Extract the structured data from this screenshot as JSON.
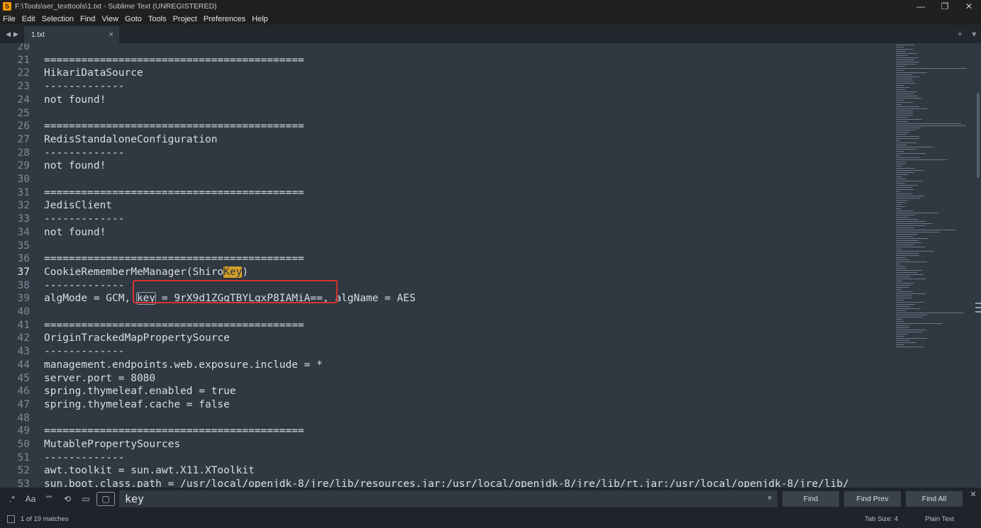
{
  "window": {
    "title": "F:\\Tools\\ser_texttools\\1.txt - Sublime Text (UNREGISTERED)"
  },
  "menu": [
    "File",
    "Edit",
    "Selection",
    "Find",
    "View",
    "Goto",
    "Tools",
    "Project",
    "Preferences",
    "Help"
  ],
  "tab": {
    "label": "1.txt",
    "close": "×"
  },
  "lines": [
    {
      "n": "20",
      "text": ""
    },
    {
      "n": "21",
      "text": "=========================================="
    },
    {
      "n": "22",
      "text": "HikariDataSource"
    },
    {
      "n": "23",
      "text": "-------------"
    },
    {
      "n": "24",
      "text": "not found!"
    },
    {
      "n": "25",
      "text": ""
    },
    {
      "n": "26",
      "text": "=========================================="
    },
    {
      "n": "27",
      "text": "RedisStandaloneConfiguration"
    },
    {
      "n": "28",
      "text": "-------------"
    },
    {
      "n": "29",
      "text": "not found!"
    },
    {
      "n": "30",
      "text": ""
    },
    {
      "n": "31",
      "text": "=========================================="
    },
    {
      "n": "32",
      "text": "JedisClient"
    },
    {
      "n": "33",
      "text": "-------------"
    },
    {
      "n": "34",
      "text": "not found!"
    },
    {
      "n": "35",
      "text": ""
    },
    {
      "n": "36",
      "text": "=========================================="
    },
    {
      "n": "37",
      "text": "",
      "pre": "CookieRememberMeManager(Shiro",
      "mark": "Key",
      "post": ")"
    },
    {
      "n": "38",
      "text": "-------------"
    },
    {
      "n": "39",
      "text": "",
      "pre": "algMode = GCM, ",
      "box": "key",
      "post": " = 9rX9d1ZGqTBYLqxP8IAMiA==, algName = AES"
    },
    {
      "n": "40",
      "text": ""
    },
    {
      "n": "41",
      "text": "=========================================="
    },
    {
      "n": "42",
      "text": "OriginTrackedMapPropertySource"
    },
    {
      "n": "43",
      "text": "-------------"
    },
    {
      "n": "44",
      "text": "management.endpoints.web.exposure.include = *"
    },
    {
      "n": "45",
      "text": "server.port = 8080"
    },
    {
      "n": "46",
      "text": "spring.thymeleaf.enabled = true"
    },
    {
      "n": "47",
      "text": "spring.thymeleaf.cache = false"
    },
    {
      "n": "48",
      "text": ""
    },
    {
      "n": "49",
      "text": "=========================================="
    },
    {
      "n": "50",
      "text": "MutablePropertySources"
    },
    {
      "n": "51",
      "text": "-------------"
    },
    {
      "n": "52",
      "text": "awt.toolkit = sun.awt.X11.XToolkit"
    },
    {
      "n": "53",
      "text": "sun.boot.class.path = /usr/local/openjdk-8/jre/lib/resources.jar:/usr/local/openjdk-8/jre/lib/rt.jar:/usr/local/openjdk-8/jre/lib/"
    }
  ],
  "active_line": "37",
  "find": {
    "query": "key",
    "buttons": {
      "find": "Find",
      "find_prev": "Find Prev",
      "find_all": "Find All"
    },
    "toggles": {
      "regex": ".*",
      "case": "Aa",
      "whole_word": "\"\"",
      "wrap": "⟲",
      "in_selection": "▭",
      "highlight": "▢"
    }
  },
  "status": {
    "matches": "1 of 19 matches",
    "tab_size": "Tab Size: 4",
    "syntax": "Plain Text"
  }
}
